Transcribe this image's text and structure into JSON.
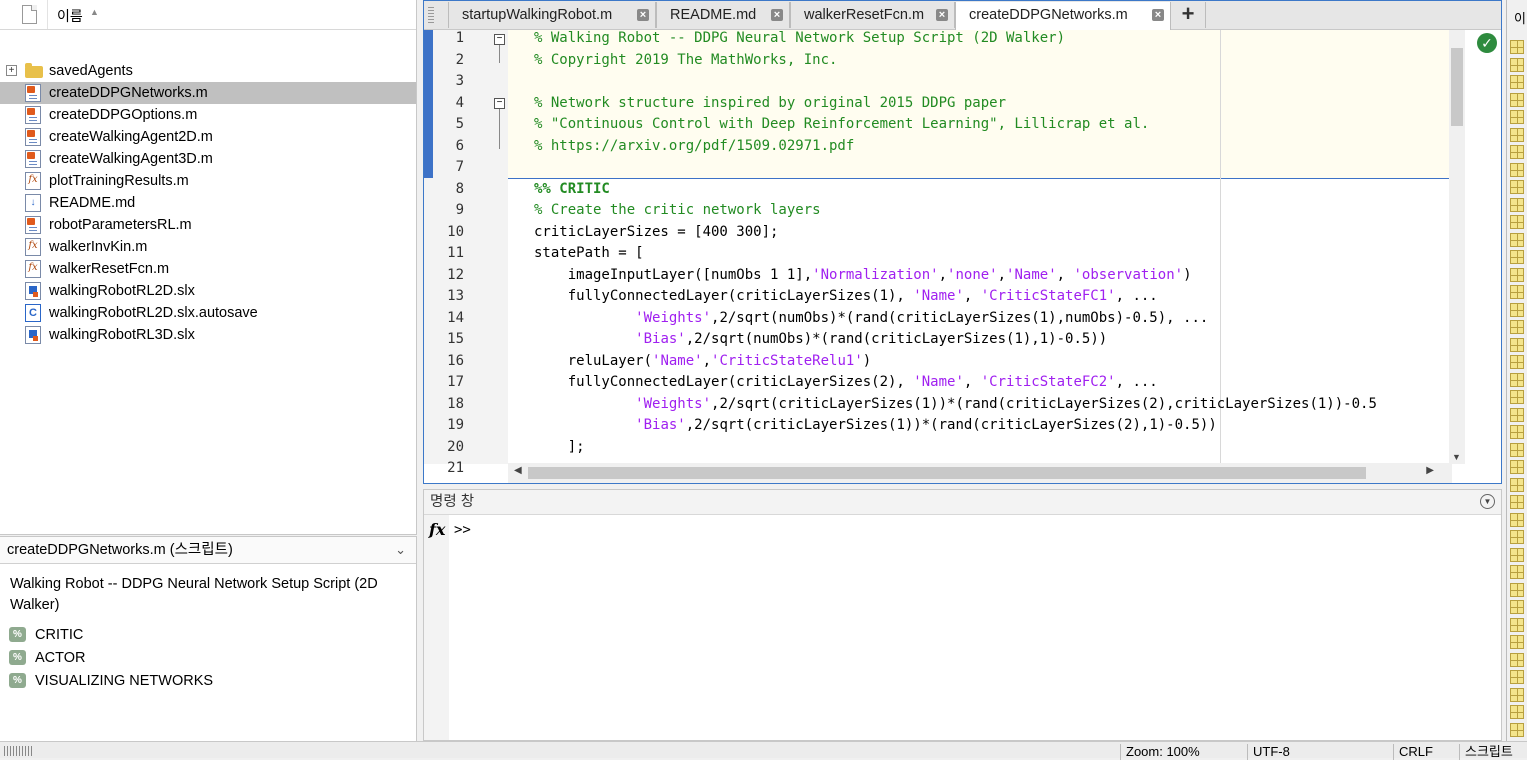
{
  "file_browser": {
    "header_name": "이름",
    "sort_indicator": "▲",
    "items": [
      {
        "name": "savedAgents",
        "icon": "folder-icon",
        "expandable": true,
        "selected": false
      },
      {
        "name": "createDDPGNetworks.m",
        "icon": "script-file-icon",
        "selected": true
      },
      {
        "name": "createDDPGOptions.m",
        "icon": "script-file-icon",
        "selected": false
      },
      {
        "name": "createWalkingAgent2D.m",
        "icon": "script-file-icon",
        "selected": false
      },
      {
        "name": "createWalkingAgent3D.m",
        "icon": "script-file-icon",
        "selected": false
      },
      {
        "name": "plotTrainingResults.m",
        "icon": "function-file-icon",
        "selected": false
      },
      {
        "name": "README.md",
        "icon": "markdown-file-icon",
        "selected": false
      },
      {
        "name": "robotParametersRL.m",
        "icon": "script-file-icon",
        "selected": false
      },
      {
        "name": "walkerInvKin.m",
        "icon": "function-file-icon",
        "selected": false
      },
      {
        "name": "walkerResetFcn.m",
        "icon": "function-file-icon",
        "selected": false
      },
      {
        "name": "walkingRobotRL2D.slx",
        "icon": "simulink-model-icon",
        "selected": false
      },
      {
        "name": "walkingRobotRL2D.slx.autosave",
        "icon": "autosave-file-icon",
        "selected": false
      },
      {
        "name": "walkingRobotRL3D.slx",
        "icon": "simulink-model-icon",
        "selected": false
      }
    ]
  },
  "details": {
    "title": "createDDPGNetworks.m  (스크립트)",
    "description": "Walking Robot -- DDPG Neural Network Setup Script (2D Walker)",
    "sections": [
      "CRITIC",
      "ACTOR",
      "VISUALIZING NETWORKS"
    ]
  },
  "editor": {
    "tabs": [
      {
        "label": "startupWalkingRobot.m",
        "active": false
      },
      {
        "label": "README.md",
        "active": false
      },
      {
        "label": "walkerResetFcn.m",
        "active": false
      },
      {
        "label": "createDDPGNetworks.m",
        "active": true
      }
    ],
    "add_tab_label": "+",
    "lines": [
      {
        "n": "1",
        "segments": [
          {
            "t": "% Walking Robot -- DDPG Neural Network Setup Script (2D Walker)",
            "c": "comment"
          }
        ]
      },
      {
        "n": "2",
        "segments": [
          {
            "t": "% Copyright 2019 The MathWorks, Inc.",
            "c": "comment"
          }
        ]
      },
      {
        "n": "3",
        "segments": []
      },
      {
        "n": "4",
        "segments": [
          {
            "t": "% Network structure inspired by original 2015 DDPG paper",
            "c": "comment"
          }
        ]
      },
      {
        "n": "5",
        "segments": [
          {
            "t": "% \"Continuous Control with Deep Reinforcement Learning\", Lillicrap et al.",
            "c": "comment"
          }
        ]
      },
      {
        "n": "6",
        "segments": [
          {
            "t": "% https://arxiv.org/pdf/1509.02971.pdf",
            "c": "comment"
          }
        ]
      },
      {
        "n": "7",
        "segments": []
      },
      {
        "n": "8",
        "segments": [
          {
            "t": "%% CRITIC",
            "c": "cell"
          }
        ]
      },
      {
        "n": "9",
        "segments": [
          {
            "t": "% Create the critic network layers",
            "c": "comment"
          }
        ]
      },
      {
        "n": "10",
        "segments": [
          {
            "t": "criticLayerSizes = [400 300];",
            "c": "code"
          }
        ]
      },
      {
        "n": "11",
        "segments": [
          {
            "t": "statePath = [",
            "c": "code"
          }
        ]
      },
      {
        "n": "12",
        "segments": [
          {
            "t": "    imageInputLayer([numObs 1 1],",
            "c": "code"
          },
          {
            "t": "'Normalization'",
            "c": "str"
          },
          {
            "t": ",",
            "c": "code"
          },
          {
            "t": "'none'",
            "c": "str"
          },
          {
            "t": ",",
            "c": "code"
          },
          {
            "t": "'Name'",
            "c": "str"
          },
          {
            "t": ", ",
            "c": "code"
          },
          {
            "t": "'observation'",
            "c": "str"
          },
          {
            "t": ")",
            "c": "code"
          }
        ]
      },
      {
        "n": "13",
        "segments": [
          {
            "t": "    fullyConnectedLayer(criticLayerSizes(1), ",
            "c": "code"
          },
          {
            "t": "'Name'",
            "c": "str"
          },
          {
            "t": ", ",
            "c": "code"
          },
          {
            "t": "'CriticStateFC1'",
            "c": "str"
          },
          {
            "t": ", ...",
            "c": "code"
          }
        ]
      },
      {
        "n": "14",
        "segments": [
          {
            "t": "            ",
            "c": "code"
          },
          {
            "t": "'Weights'",
            "c": "str"
          },
          {
            "t": ",2/sqrt(numObs)*(rand(criticLayerSizes(1),numObs)-0.5), ...",
            "c": "code"
          }
        ]
      },
      {
        "n": "15",
        "segments": [
          {
            "t": "            ",
            "c": "code"
          },
          {
            "t": "'Bias'",
            "c": "str"
          },
          {
            "t": ",2/sqrt(numObs)*(rand(criticLayerSizes(1),1)-0.5))",
            "c": "code"
          }
        ]
      },
      {
        "n": "16",
        "segments": [
          {
            "t": "    reluLayer(",
            "c": "code"
          },
          {
            "t": "'Name'",
            "c": "str"
          },
          {
            "t": ",",
            "c": "code"
          },
          {
            "t": "'CriticStateRelu1'",
            "c": "str"
          },
          {
            "t": ")",
            "c": "code"
          }
        ]
      },
      {
        "n": "17",
        "segments": [
          {
            "t": "    fullyConnectedLayer(criticLayerSizes(2), ",
            "c": "code"
          },
          {
            "t": "'Name'",
            "c": "str"
          },
          {
            "t": ", ",
            "c": "code"
          },
          {
            "t": "'CriticStateFC2'",
            "c": "str"
          },
          {
            "t": ", ...",
            "c": "code"
          }
        ]
      },
      {
        "n": "18",
        "segments": [
          {
            "t": "            ",
            "c": "code"
          },
          {
            "t": "'Weights'",
            "c": "str"
          },
          {
            "t": ",2/sqrt(criticLayerSizes(1))*(rand(criticLayerSizes(2),criticLayerSizes(1))-0.5",
            "c": "code"
          }
        ]
      },
      {
        "n": "19",
        "segments": [
          {
            "t": "            ",
            "c": "code"
          },
          {
            "t": "'Bias'",
            "c": "str"
          },
          {
            "t": ",2/sqrt(criticLayerSizes(1))*(rand(criticLayerSizes(2),1)-0.5))",
            "c": "code"
          }
        ]
      },
      {
        "n": "20",
        "segments": [
          {
            "t": "    ];",
            "c": "code"
          }
        ]
      },
      {
        "n": "21",
        "segments": []
      }
    ]
  },
  "command_window": {
    "title": "명령 창",
    "fx_label": "fx",
    "prompt": ">>"
  },
  "right_strip": {
    "label": "이"
  },
  "status_bar": {
    "zoom": "Zoom: 100%",
    "encoding": "UTF-8",
    "line_ending": "CRLF",
    "file_type": "스크립트"
  },
  "colors": {
    "accent": "#3d72c7",
    "comment": "#228b22",
    "string": "#a020f0",
    "selection": "#c0c0c0",
    "ok_status": "#2e8b3e"
  }
}
